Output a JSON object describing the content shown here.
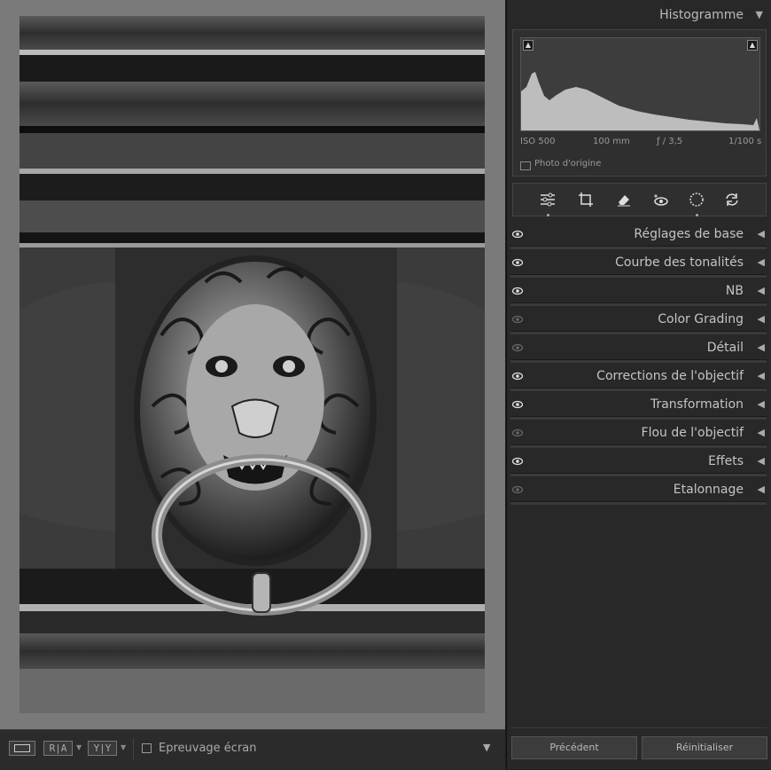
{
  "histogram": {
    "title": "Histogramme",
    "iso": "ISO 500",
    "focal_length": "100 mm",
    "aperture": "ƒ / 3,5",
    "shutter": "1/100 s",
    "original_photo_label": "Photo d'origine"
  },
  "tools": [
    "sliders-icon",
    "crop-icon",
    "eraser-icon",
    "redeye-icon",
    "mask-icon",
    "reset-icon"
  ],
  "sections": [
    {
      "label": "Réglages de base",
      "eye_on": true
    },
    {
      "label": "Courbe des tonalités",
      "eye_on": true
    },
    {
      "label": "NB",
      "eye_on": true
    },
    {
      "label": "Color Grading",
      "eye_on": false
    },
    {
      "label": "Détail",
      "eye_on": false
    },
    {
      "label": "Corrections de l'objectif",
      "eye_on": true
    },
    {
      "label": "Transformation",
      "eye_on": true
    },
    {
      "label": "Flou de l'objectif",
      "eye_on": false
    },
    {
      "label": "Effets",
      "eye_on": true
    },
    {
      "label": "Etalonnage",
      "eye_on": false
    }
  ],
  "toolbar": {
    "view_modes": [
      "R|A",
      "Y|Y"
    ],
    "softproof_label": "Epreuvage écran"
  },
  "footer": {
    "previous_label": "Précédent",
    "reset_label": "Réinitialiser"
  },
  "colors": {
    "panel_bg": "#282828",
    "viewer_bg": "#7a7a7a"
  }
}
